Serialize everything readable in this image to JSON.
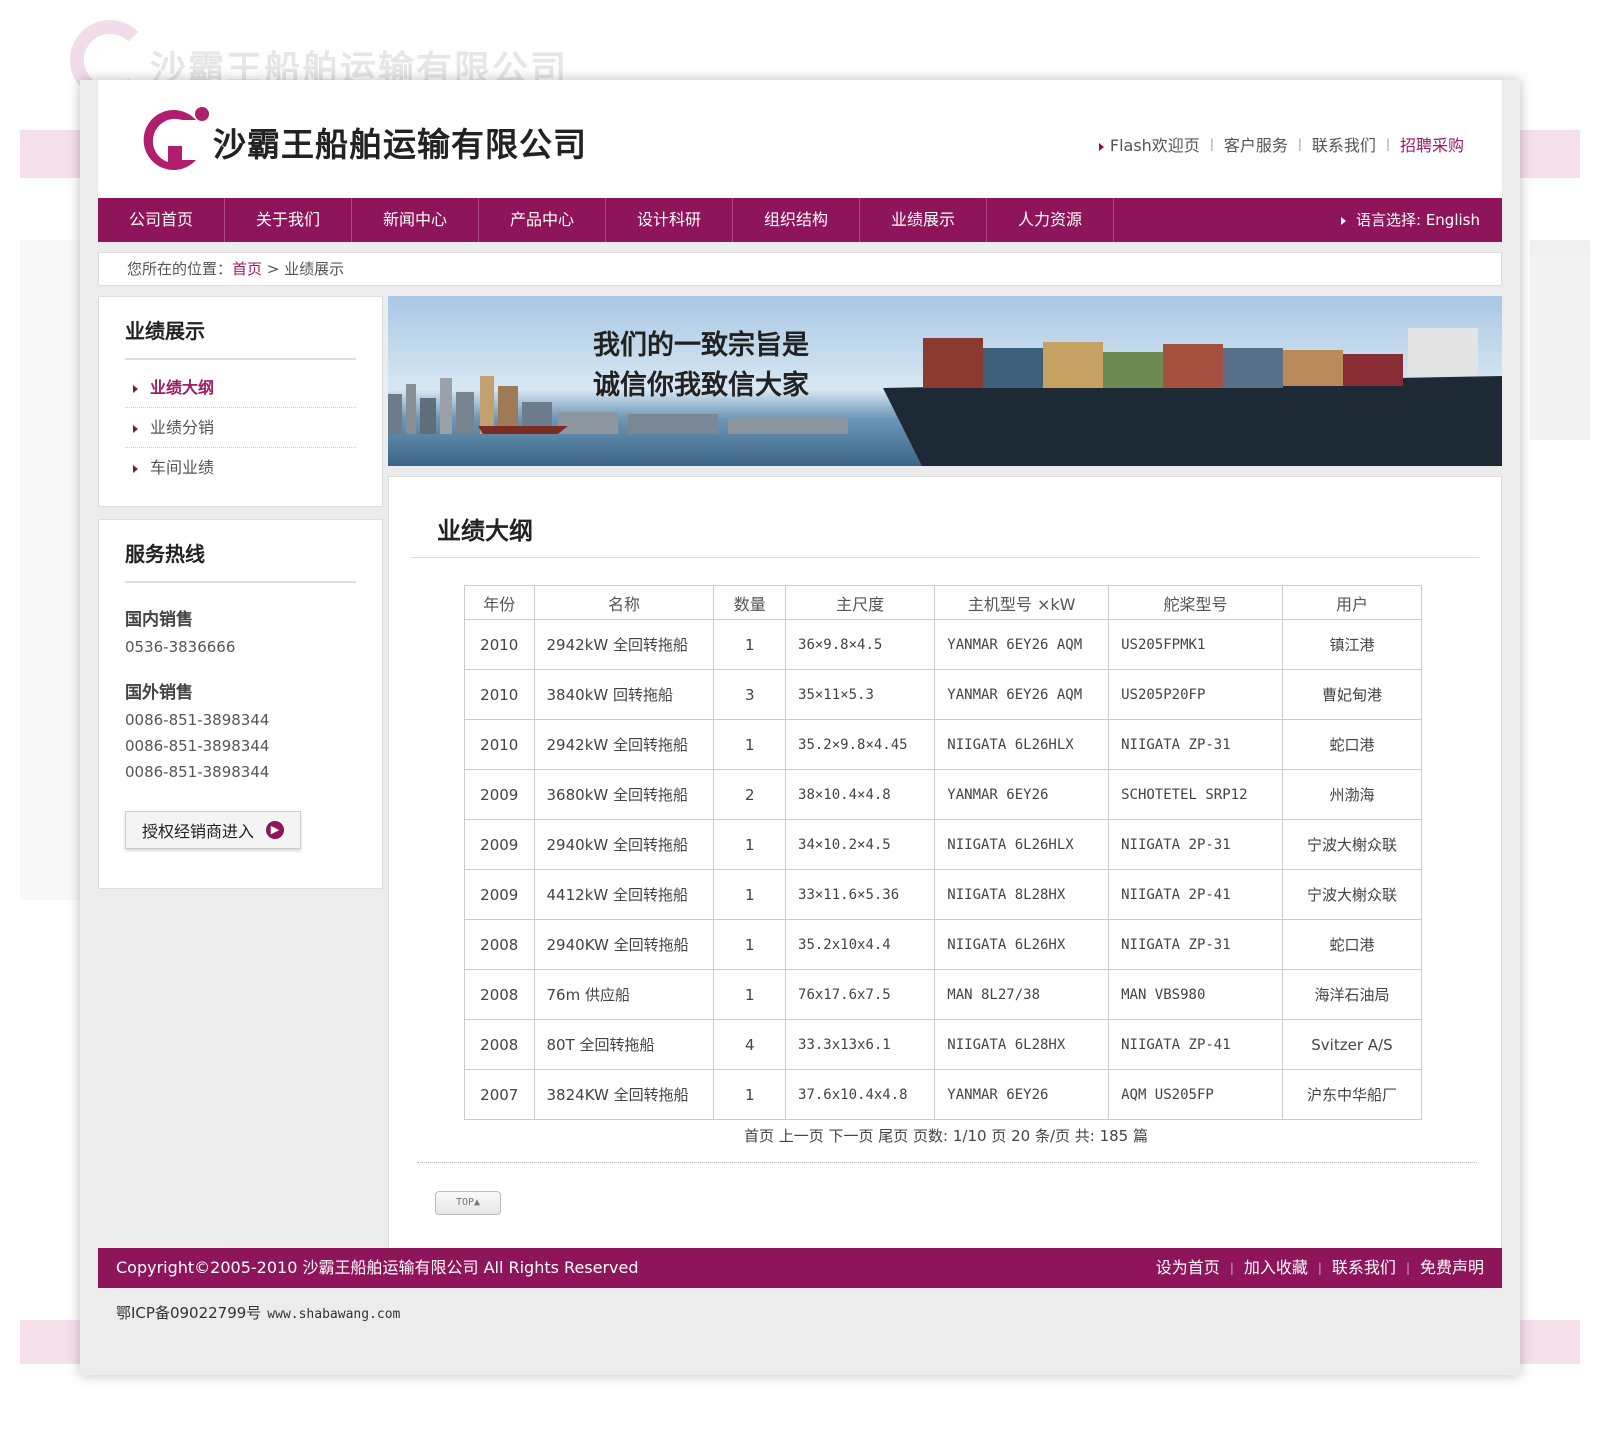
{
  "company_name": "沙霸王船舶运输有限公司",
  "top_links": {
    "flash": "Flash欢迎页",
    "service": "客户服务",
    "contact": "联系我们",
    "recruit": "招聘采购",
    "sep1": "|",
    "sep2": "|",
    "sep3": "|"
  },
  "nav": {
    "items": [
      "公司首页",
      "关于我们",
      "新闻中心",
      "产品中心",
      "设计科研",
      "组织结构",
      "业绩展示",
      "人力资源"
    ],
    "language": "语言选择: English"
  },
  "breadcrumb": {
    "prefix": "您所在的位置：",
    "home": "首页",
    "current": " > 业绩展示"
  },
  "sidebar": {
    "title": "业绩展示",
    "items": [
      "业绩大纲",
      "业绩分销",
      "车间业绩"
    ],
    "hotline": {
      "title": "服务热线",
      "domestic_label": "国内销售",
      "domestic_numbers": [
        "0536-3836666"
      ],
      "foreign_label": "国外销售",
      "foreign_numbers": [
        "0086-851-3898344",
        "0086-851-3898344",
        "0086-851-3898344"
      ],
      "dealer_button": "授权经销商进入"
    }
  },
  "banner": {
    "line1": "我们的一致宗旨是",
    "line2": "诚信你我致信大家"
  },
  "main": {
    "title": "业绩大纲",
    "columns": [
      "年份",
      "名称",
      "数量",
      "主尺度",
      "主机型号 ×kW",
      "舵桨型号",
      "用户"
    ],
    "rows": [
      [
        "2010",
        "2942kW 全回转拖船",
        "1",
        "36×9.8×4.5",
        "YANMAR 6EY26 AQM",
        "US205FPMK1",
        "镇江港"
      ],
      [
        "2010",
        "3840kW 回转拖船",
        "3",
        "35×11×5.3",
        "YANMAR 6EY26 AQM",
        "US205P20FP",
        "曹妃甸港"
      ],
      [
        "2010",
        "2942kW 全回转拖船",
        "1",
        "35.2×9.8×4.45",
        "NIIGATA 6L26HLX",
        "NIIGATA ZP-31",
        "蛇口港"
      ],
      [
        "2009",
        "3680kW 全回转拖船",
        "2",
        "38×10.4×4.8",
        "YANMAR 6EY26",
        "SCHOTETEL SRP12",
        "州渤海"
      ],
      [
        "2009",
        "2940kW 全回转拖船",
        "1",
        "34×10.2×4.5",
        "NIIGATA 6L26HLX",
        "NIIGATA 2P-31",
        "宁波大榭众联"
      ],
      [
        "2009",
        "4412kW 全回转拖船",
        "1",
        "33×11.6×5.36",
        "NIIGATA 8L28HX",
        "NIIGATA 2P-41",
        "宁波大榭众联"
      ],
      [
        "2008",
        "2940KW 全回转拖船",
        "1",
        "35.2x10x4.4",
        "NIIGATA 6L26HX",
        "NIIGATA ZP-31",
        "蛇口港"
      ],
      [
        "2008",
        "76m 供应船",
        "1",
        "76x17.6x7.5",
        "MAN 8L27/38",
        "MAN VBS980",
        "海洋石油局"
      ],
      [
        "2008",
        "80T 全回转拖船",
        "4",
        "33.3x13x6.1",
        "NIIGATA 6L28HX",
        "NIIGATA ZP-41",
        "Svitzer A/S"
      ],
      [
        "2007",
        "3824KW 全回转拖船",
        "1",
        "37.6x10.4x4.8",
        "YANMAR 6EY26",
        "AQM US205FP",
        "沪东中华船厂"
      ]
    ],
    "pager": "首页 上一页 下一页 尾页 页数: 1/10 页 20 条/页 共: 185 篇",
    "top_button": "TOP▲"
  },
  "footer": {
    "copyright": "Copyright©2005-2010 沙霸王船舶运输有限公司 All Rights Reserved",
    "links": [
      "设为首页",
      "加入收藏",
      "联系我们",
      "免费声明"
    ],
    "icp": "鄂ICP备09022799号",
    "url": "www.shabawang.com"
  },
  "colors": {
    "brand": "#8e1559",
    "accent": "#a01a65"
  },
  "icons": [
    "logo-mark",
    "arrow-right-icon",
    "enter-circle-icon"
  ]
}
